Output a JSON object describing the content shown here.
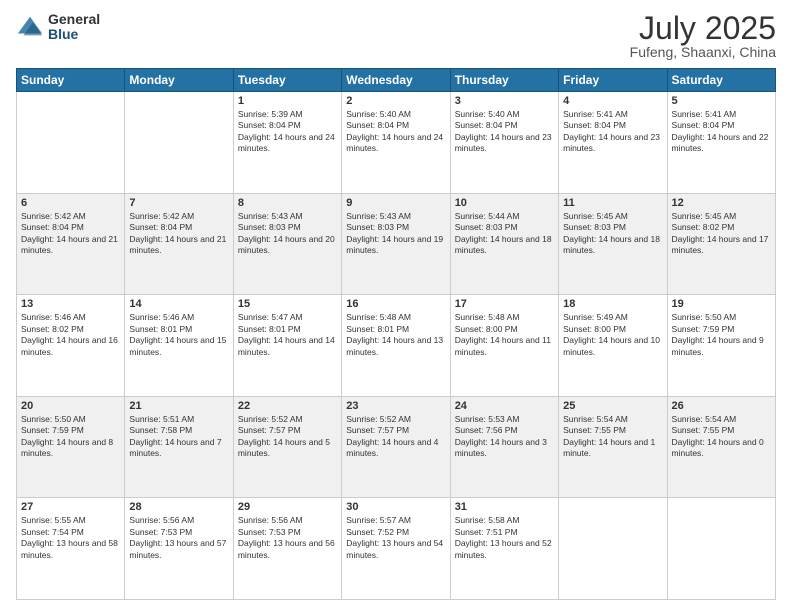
{
  "header": {
    "logo_general": "General",
    "logo_blue": "Blue",
    "month_title": "July 2025",
    "location": "Fufeng, Shaanxi, China"
  },
  "days_of_week": [
    "Sunday",
    "Monday",
    "Tuesday",
    "Wednesday",
    "Thursday",
    "Friday",
    "Saturday"
  ],
  "weeks": [
    [
      {
        "day": "",
        "sunrise": "",
        "sunset": "",
        "daylight": ""
      },
      {
        "day": "",
        "sunrise": "",
        "sunset": "",
        "daylight": ""
      },
      {
        "day": "1",
        "sunrise": "Sunrise: 5:39 AM",
        "sunset": "Sunset: 8:04 PM",
        "daylight": "Daylight: 14 hours and 24 minutes."
      },
      {
        "day": "2",
        "sunrise": "Sunrise: 5:40 AM",
        "sunset": "Sunset: 8:04 PM",
        "daylight": "Daylight: 14 hours and 24 minutes."
      },
      {
        "day": "3",
        "sunrise": "Sunrise: 5:40 AM",
        "sunset": "Sunset: 8:04 PM",
        "daylight": "Daylight: 14 hours and 23 minutes."
      },
      {
        "day": "4",
        "sunrise": "Sunrise: 5:41 AM",
        "sunset": "Sunset: 8:04 PM",
        "daylight": "Daylight: 14 hours and 23 minutes."
      },
      {
        "day": "5",
        "sunrise": "Sunrise: 5:41 AM",
        "sunset": "Sunset: 8:04 PM",
        "daylight": "Daylight: 14 hours and 22 minutes."
      }
    ],
    [
      {
        "day": "6",
        "sunrise": "Sunrise: 5:42 AM",
        "sunset": "Sunset: 8:04 PM",
        "daylight": "Daylight: 14 hours and 21 minutes."
      },
      {
        "day": "7",
        "sunrise": "Sunrise: 5:42 AM",
        "sunset": "Sunset: 8:04 PM",
        "daylight": "Daylight: 14 hours and 21 minutes."
      },
      {
        "day": "8",
        "sunrise": "Sunrise: 5:43 AM",
        "sunset": "Sunset: 8:03 PM",
        "daylight": "Daylight: 14 hours and 20 minutes."
      },
      {
        "day": "9",
        "sunrise": "Sunrise: 5:43 AM",
        "sunset": "Sunset: 8:03 PM",
        "daylight": "Daylight: 14 hours and 19 minutes."
      },
      {
        "day": "10",
        "sunrise": "Sunrise: 5:44 AM",
        "sunset": "Sunset: 8:03 PM",
        "daylight": "Daylight: 14 hours and 18 minutes."
      },
      {
        "day": "11",
        "sunrise": "Sunrise: 5:45 AM",
        "sunset": "Sunset: 8:03 PM",
        "daylight": "Daylight: 14 hours and 18 minutes."
      },
      {
        "day": "12",
        "sunrise": "Sunrise: 5:45 AM",
        "sunset": "Sunset: 8:02 PM",
        "daylight": "Daylight: 14 hours and 17 minutes."
      }
    ],
    [
      {
        "day": "13",
        "sunrise": "Sunrise: 5:46 AM",
        "sunset": "Sunset: 8:02 PM",
        "daylight": "Daylight: 14 hours and 16 minutes."
      },
      {
        "day": "14",
        "sunrise": "Sunrise: 5:46 AM",
        "sunset": "Sunset: 8:01 PM",
        "daylight": "Daylight: 14 hours and 15 minutes."
      },
      {
        "day": "15",
        "sunrise": "Sunrise: 5:47 AM",
        "sunset": "Sunset: 8:01 PM",
        "daylight": "Daylight: 14 hours and 14 minutes."
      },
      {
        "day": "16",
        "sunrise": "Sunrise: 5:48 AM",
        "sunset": "Sunset: 8:01 PM",
        "daylight": "Daylight: 14 hours and 13 minutes."
      },
      {
        "day": "17",
        "sunrise": "Sunrise: 5:48 AM",
        "sunset": "Sunset: 8:00 PM",
        "daylight": "Daylight: 14 hours and 11 minutes."
      },
      {
        "day": "18",
        "sunrise": "Sunrise: 5:49 AM",
        "sunset": "Sunset: 8:00 PM",
        "daylight": "Daylight: 14 hours and 10 minutes."
      },
      {
        "day": "19",
        "sunrise": "Sunrise: 5:50 AM",
        "sunset": "Sunset: 7:59 PM",
        "daylight": "Daylight: 14 hours and 9 minutes."
      }
    ],
    [
      {
        "day": "20",
        "sunrise": "Sunrise: 5:50 AM",
        "sunset": "Sunset: 7:59 PM",
        "daylight": "Daylight: 14 hours and 8 minutes."
      },
      {
        "day": "21",
        "sunrise": "Sunrise: 5:51 AM",
        "sunset": "Sunset: 7:58 PM",
        "daylight": "Daylight: 14 hours and 7 minutes."
      },
      {
        "day": "22",
        "sunrise": "Sunrise: 5:52 AM",
        "sunset": "Sunset: 7:57 PM",
        "daylight": "Daylight: 14 hours and 5 minutes."
      },
      {
        "day": "23",
        "sunrise": "Sunrise: 5:52 AM",
        "sunset": "Sunset: 7:57 PM",
        "daylight": "Daylight: 14 hours and 4 minutes."
      },
      {
        "day": "24",
        "sunrise": "Sunrise: 5:53 AM",
        "sunset": "Sunset: 7:56 PM",
        "daylight": "Daylight: 14 hours and 3 minutes."
      },
      {
        "day": "25",
        "sunrise": "Sunrise: 5:54 AM",
        "sunset": "Sunset: 7:55 PM",
        "daylight": "Daylight: 14 hours and 1 minute."
      },
      {
        "day": "26",
        "sunrise": "Sunrise: 5:54 AM",
        "sunset": "Sunset: 7:55 PM",
        "daylight": "Daylight: 14 hours and 0 minutes."
      }
    ],
    [
      {
        "day": "27",
        "sunrise": "Sunrise: 5:55 AM",
        "sunset": "Sunset: 7:54 PM",
        "daylight": "Daylight: 13 hours and 58 minutes."
      },
      {
        "day": "28",
        "sunrise": "Sunrise: 5:56 AM",
        "sunset": "Sunset: 7:53 PM",
        "daylight": "Daylight: 13 hours and 57 minutes."
      },
      {
        "day": "29",
        "sunrise": "Sunrise: 5:56 AM",
        "sunset": "Sunset: 7:53 PM",
        "daylight": "Daylight: 13 hours and 56 minutes."
      },
      {
        "day": "30",
        "sunrise": "Sunrise: 5:57 AM",
        "sunset": "Sunset: 7:52 PM",
        "daylight": "Daylight: 13 hours and 54 minutes."
      },
      {
        "day": "31",
        "sunrise": "Sunrise: 5:58 AM",
        "sunset": "Sunset: 7:51 PM",
        "daylight": "Daylight: 13 hours and 52 minutes."
      },
      {
        "day": "",
        "sunrise": "",
        "sunset": "",
        "daylight": ""
      },
      {
        "day": "",
        "sunrise": "",
        "sunset": "",
        "daylight": ""
      }
    ]
  ]
}
